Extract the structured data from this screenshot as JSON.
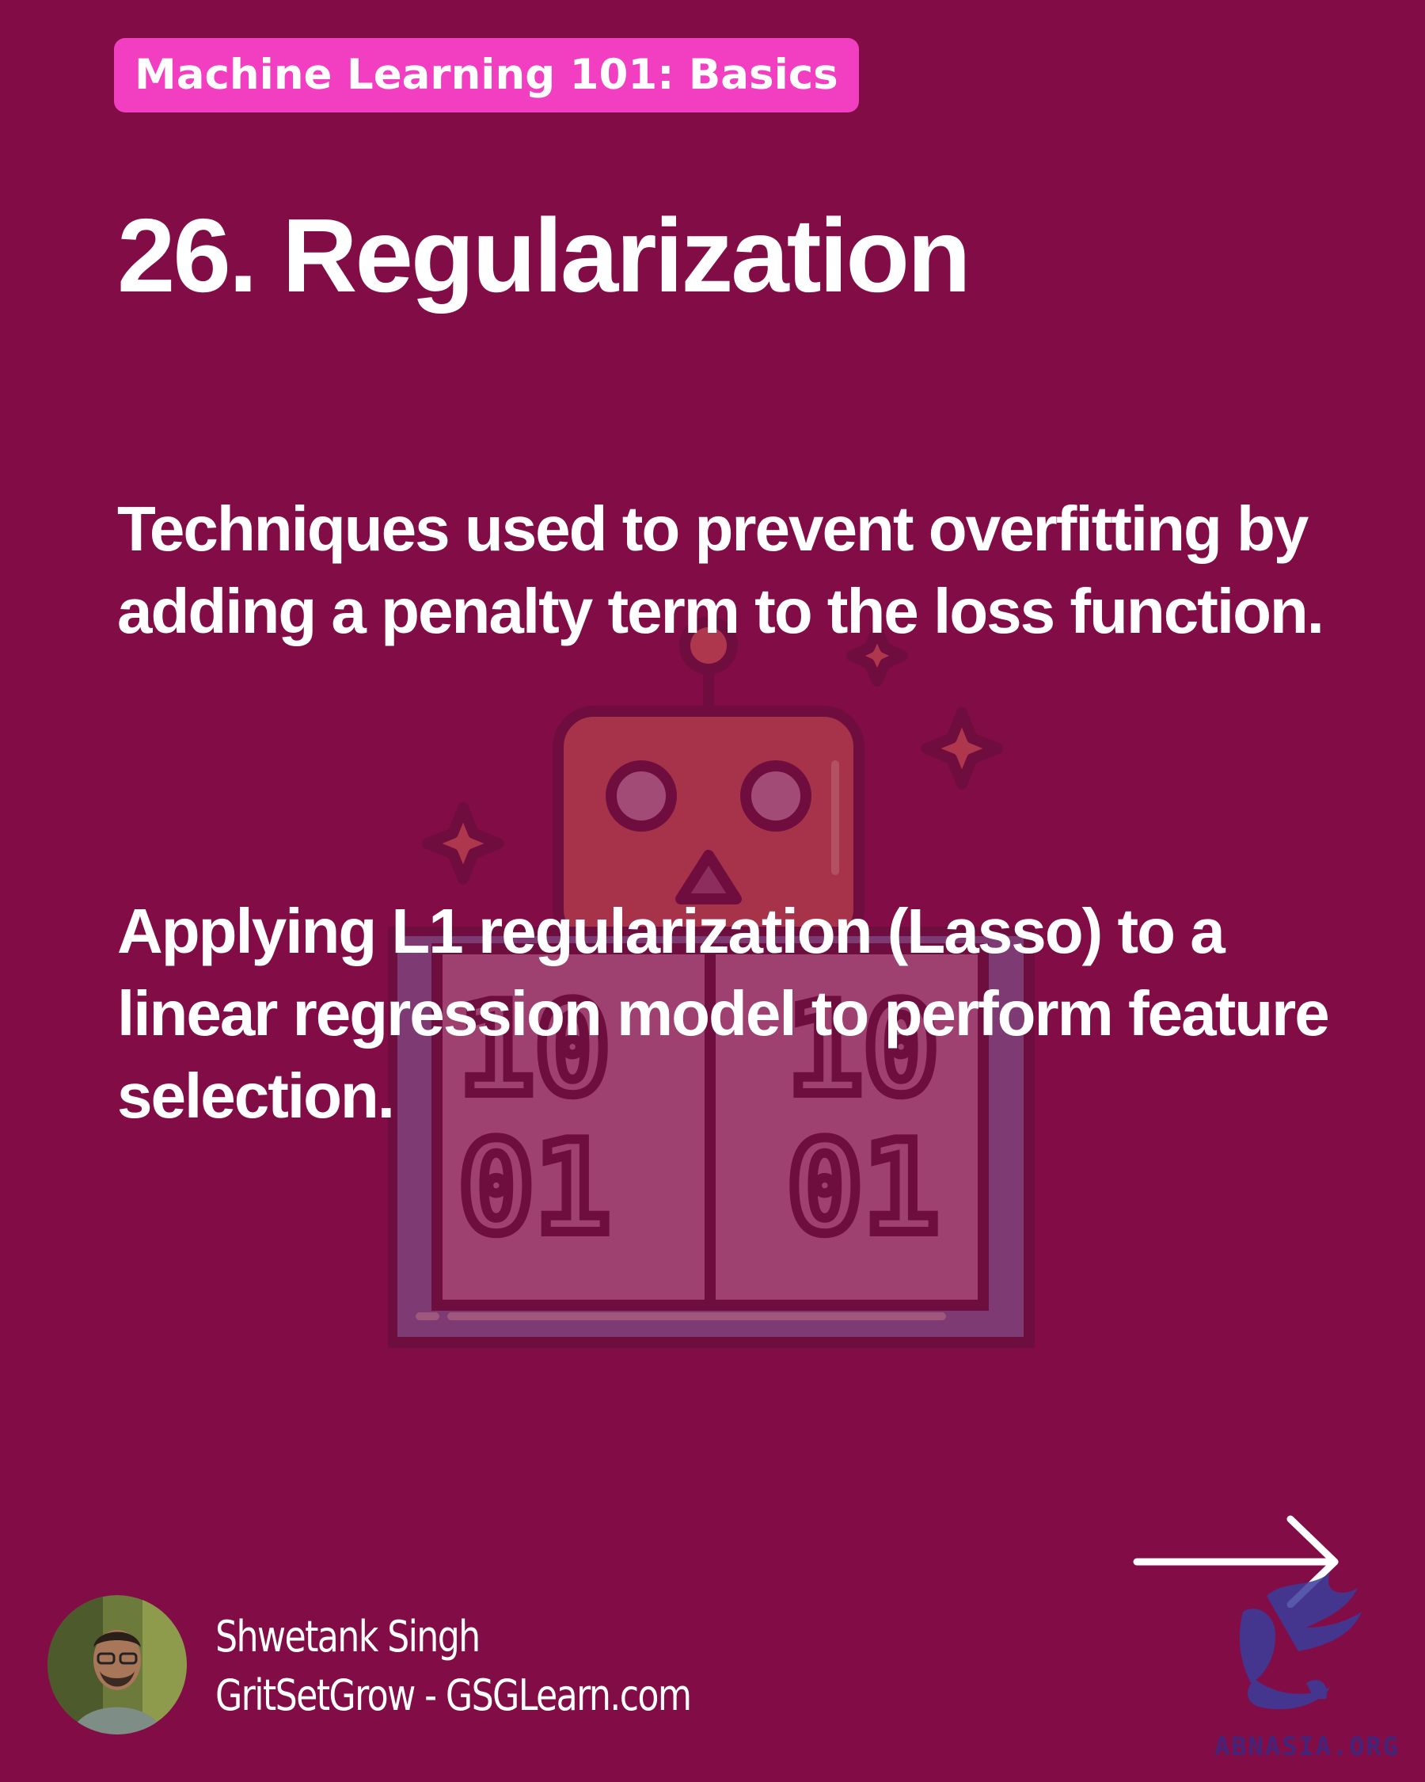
{
  "series": {
    "label": "Machine Learning 101: Basics"
  },
  "slide": {
    "title": "26. Regularization",
    "definition": "Techniques used to prevent overfitting by adding a penalty term to the loss function.",
    "example": "Applying L1 regularization (Lasso) to a linear regression model to perform feature selection."
  },
  "illustration": {
    "icon": "robot-binary-screen-icon",
    "screen_top": [
      "10",
      "10"
    ],
    "screen_bottom": [
      "01",
      "01"
    ]
  },
  "navigation": {
    "next_icon": "arrow-right-icon"
  },
  "author": {
    "name": "Shwetank Singh",
    "site": "GritSetGrow - GSGLearn.com"
  },
  "watermark": {
    "text": "ABNASIA.ORG",
    "icon": "griffin-logo-icon"
  },
  "colors": {
    "background": "#820D46",
    "badge": "#F23EC0",
    "text": "#FFFFFF",
    "illustration_outline": "#6E0E3E",
    "robot_head": "#A8364A",
    "screen_fill": "#9E4070",
    "screen_frame": "#7E3A72",
    "watermark": "#2D2E8C"
  }
}
